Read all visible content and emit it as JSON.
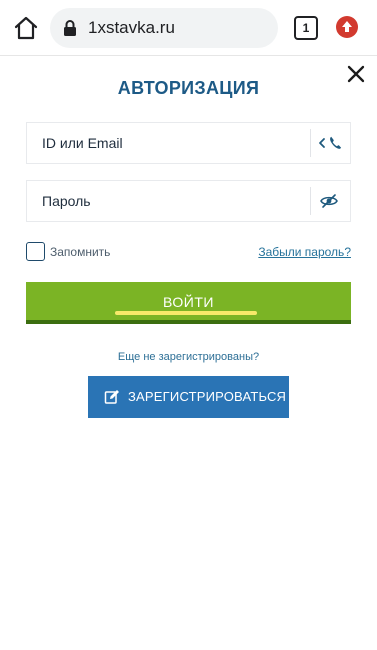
{
  "browser": {
    "url": "1xstavka.ru",
    "tab_count": "1",
    "icons": {
      "home": "home-icon",
      "lock": "lock-icon",
      "tabs": "tabs-icon",
      "upload": "upload-icon"
    }
  },
  "auth": {
    "title": "АВТОРИЗАЦИЯ",
    "login_placeholder": "ID или Email",
    "password_placeholder": "Пароль",
    "remember_label": "Запомнить",
    "forgot_link": "Забыли пароль?",
    "login_button": "ВОЙТИ",
    "not_registered": "Еще не зарегистрированы?",
    "register_button": "ЗАРЕГИСТРИРОВАТЬСЯ"
  },
  "colors": {
    "title": "#1d5a86",
    "login_button": "#7bb425",
    "register_button": "#2a74b5",
    "link": "#26739b"
  }
}
